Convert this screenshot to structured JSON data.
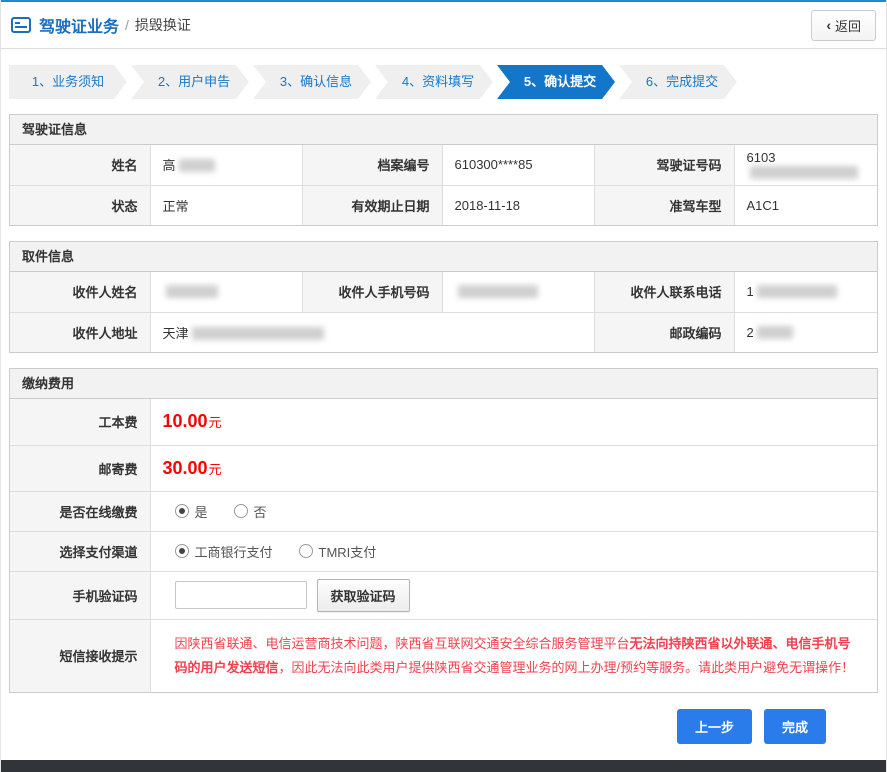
{
  "header": {
    "title": "驾驶证业务",
    "separator": "/",
    "subtitle": "损毁换证",
    "back_chevron": "‹",
    "back_label": "返回"
  },
  "steps": [
    {
      "label": "1、业务须知",
      "active": false
    },
    {
      "label": "2、用户申告",
      "active": false
    },
    {
      "label": "3、确认信息",
      "active": false
    },
    {
      "label": "4、资料填写",
      "active": false
    },
    {
      "label": "5、确认提交",
      "active": true
    },
    {
      "label": "6、完成提交",
      "active": false
    }
  ],
  "license_section": {
    "title": "驾驶证信息",
    "row1": {
      "c1_label": "姓名",
      "c1_value": "高",
      "c2_label": "档案编号",
      "c2_value": "610300****85",
      "c3_label": "驾驶证号码",
      "c3_value": "6103"
    },
    "row2": {
      "c1_label": "状态",
      "c1_value": "正常",
      "c2_label": "有效期止日期",
      "c2_value": "2018-11-18",
      "c3_label": "准驾车型",
      "c3_value": "A1C1"
    }
  },
  "pickup_section": {
    "title": "取件信息",
    "row1": {
      "c1_label": "收件人姓名",
      "c1_value": "",
      "c2_label": "收件人手机号码",
      "c2_value": "",
      "c3_label": "收件人联系电话",
      "c3_value": "1"
    },
    "row2": {
      "c1_label": "收件人地址",
      "c1_value": "天津",
      "c2_label": "邮政编码",
      "c2_value": "2"
    }
  },
  "fees_section": {
    "title": "缴纳费用",
    "base_fee": {
      "label": "工本费",
      "amount": "10.00",
      "unit": "元"
    },
    "mail_fee": {
      "label": "邮寄费",
      "amount": "30.00",
      "unit": "元"
    },
    "online_pay": {
      "label": "是否在线缴费",
      "yes": "是",
      "no": "否"
    },
    "channel": {
      "label": "选择支付渠道",
      "opt1": "工商银行支付",
      "opt2": "TMRI支付"
    },
    "captcha": {
      "label": "手机验证码",
      "value": "",
      "button": "获取验证码"
    },
    "sms": {
      "label": "短信接收提示",
      "part1": "因陕西省联通、电信运营商技术问题，陕西省互联网交通安全综合服务管理平台",
      "bold": "无法向持陕西省以外联通、电信手机号码的用户发送短信",
      "part2": "，因此无法向此类用户提供陕西省交通管理业务的网上办理/预约等服务。请此类用户避免无谓操作！"
    }
  },
  "actions": {
    "prev": "上一步",
    "finish": "完成"
  },
  "colors": {
    "accent_blue": "#1276cb",
    "button_blue": "#2a7cea",
    "fee_red": "#ff0000",
    "warning_red": "#f0414e",
    "footer_dark": "#31353a"
  }
}
